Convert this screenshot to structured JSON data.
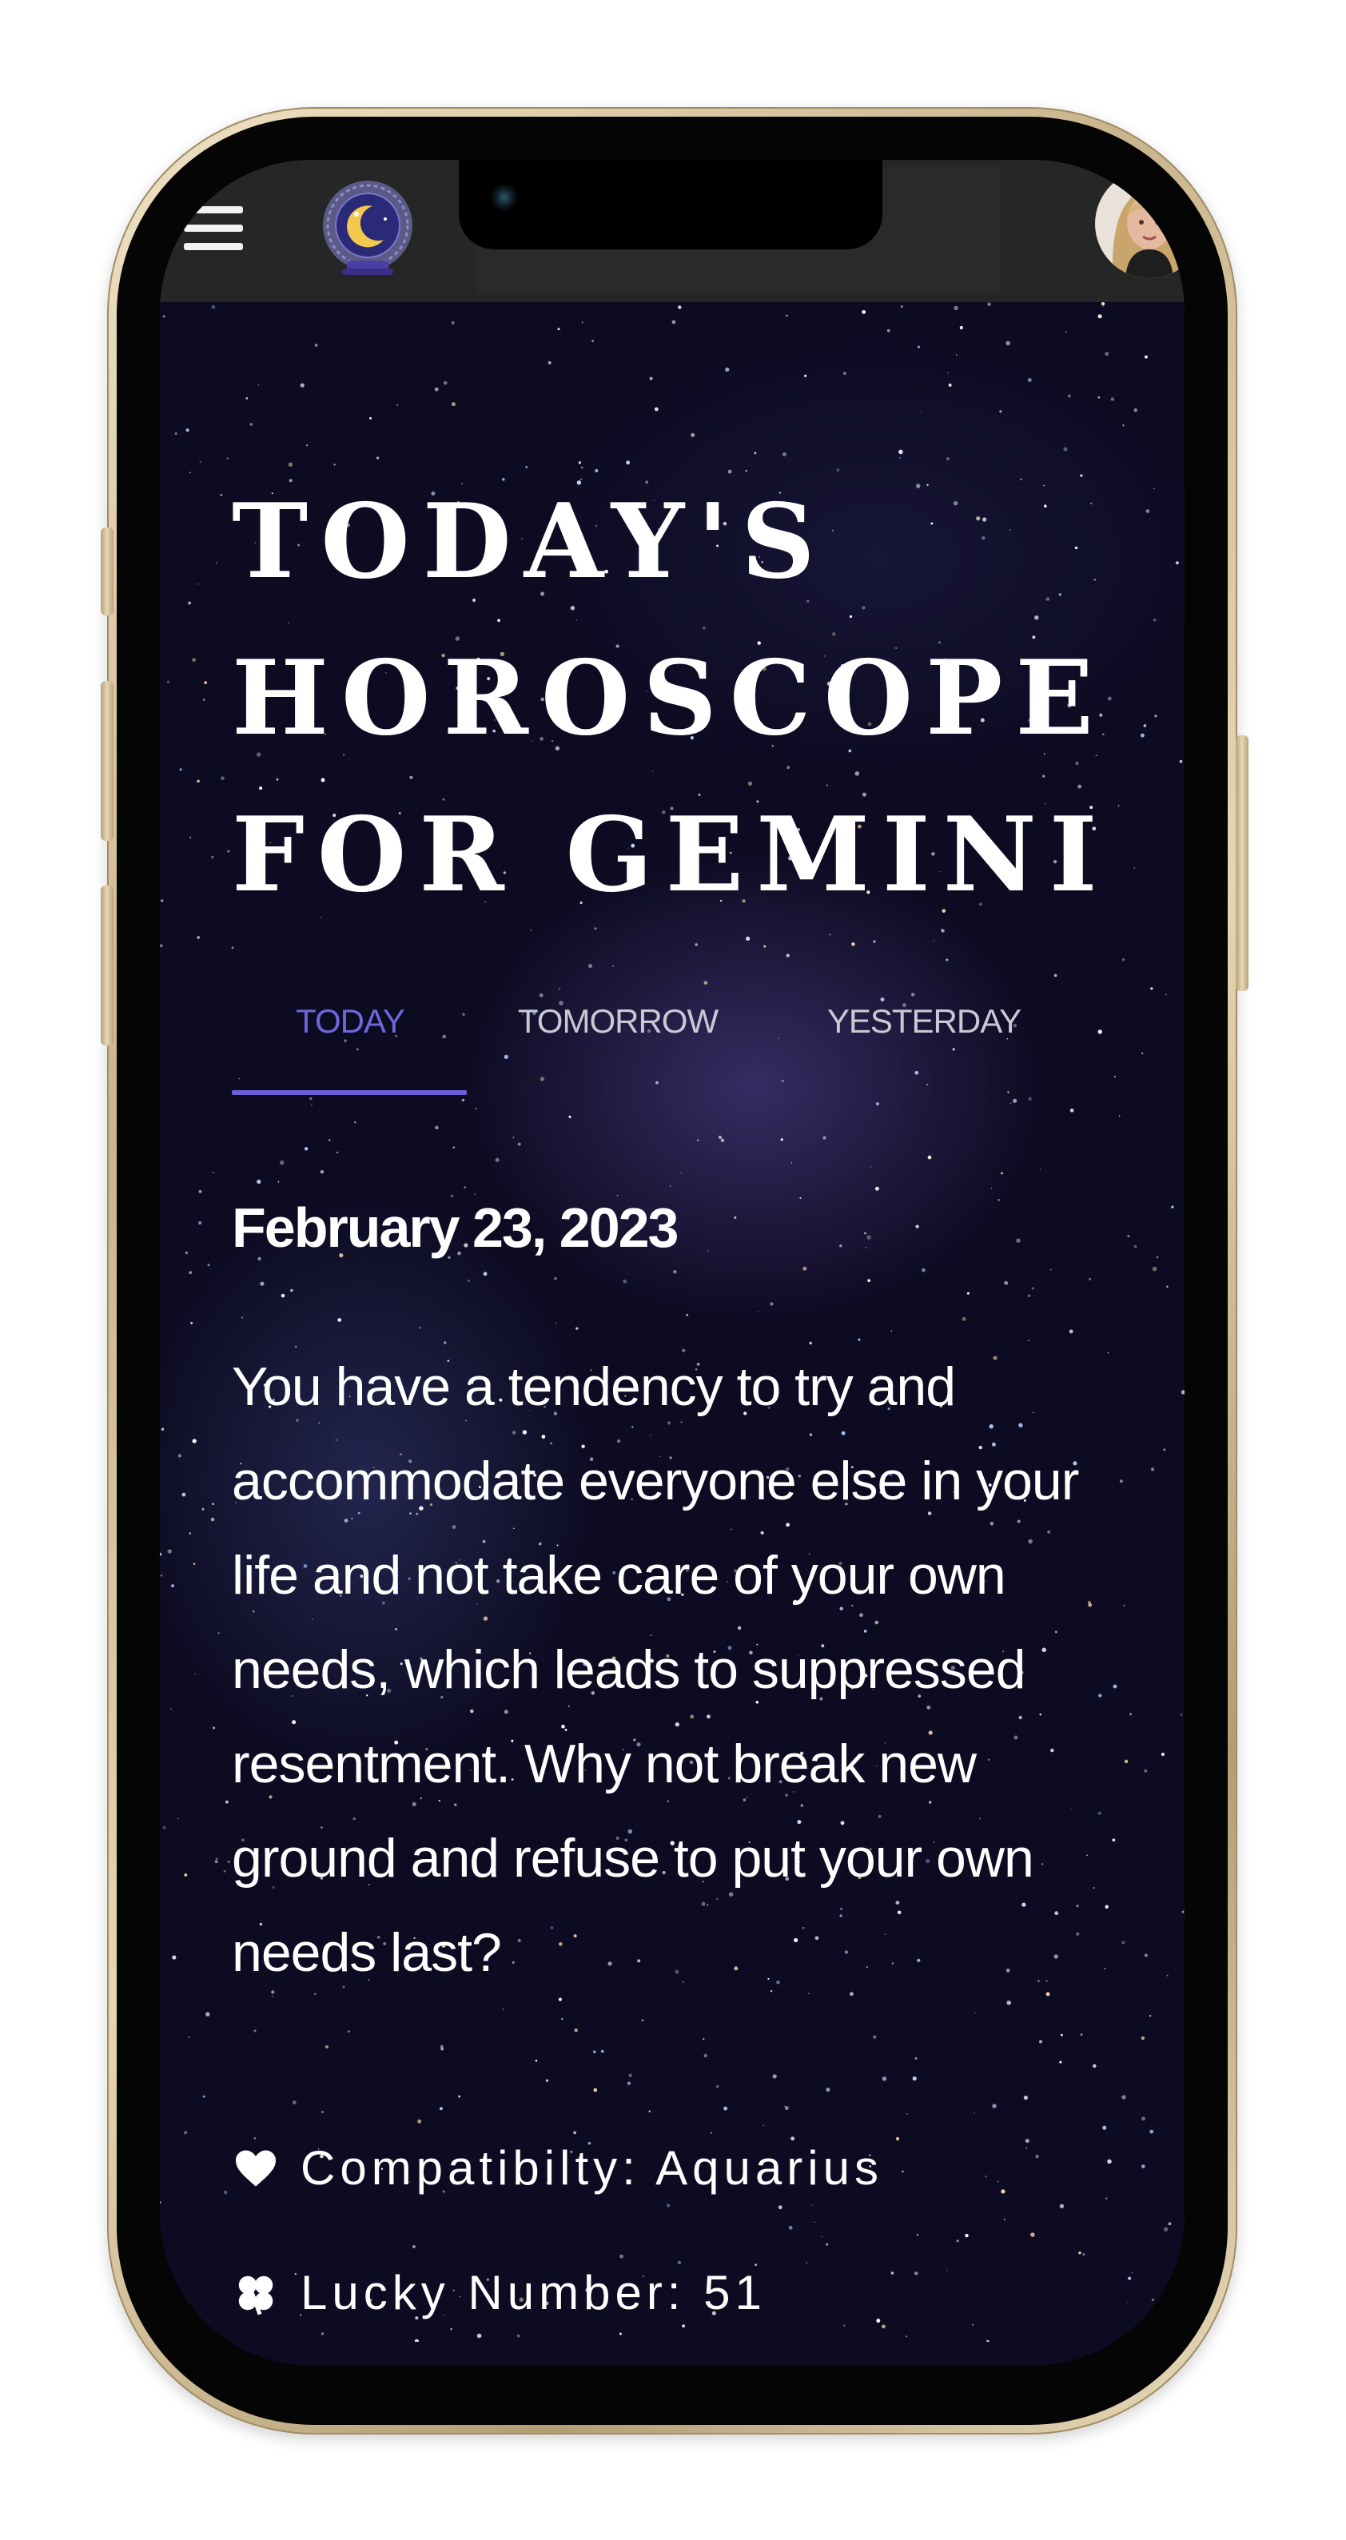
{
  "header": {
    "menu_icon": "hamburger-menu-icon",
    "logo_icon": "crescent-moon-crystal-ball-icon",
    "avatar_icon": "user-avatar"
  },
  "title": {
    "line1": "TODAY'S",
    "line2": "HOROSCOPE",
    "line3": "FOR GEMINI"
  },
  "tabs": [
    {
      "label": "TODAY",
      "active": true
    },
    {
      "label": "TOMORROW",
      "active": false
    },
    {
      "label": "YESTERDAY",
      "active": false
    }
  ],
  "reading": {
    "date": "February 23, 2023",
    "text": "You have a tendency to try and accommodate everyone else in your life and not take care of your own needs, which leads to suppressed resentment. Why not break new ground and refuse to put your own needs last?"
  },
  "details": {
    "compatibility": "Compatibilty: Aquarius",
    "compatibility_icon": "heart-icon",
    "lucky_number": "Lucky Number: 51",
    "lucky_icon": "clover-icon"
  },
  "colors": {
    "accent": "#6a5fd6",
    "header_bg": "#262626",
    "background": "#0d0b22",
    "frame": "#d8c7a0"
  }
}
